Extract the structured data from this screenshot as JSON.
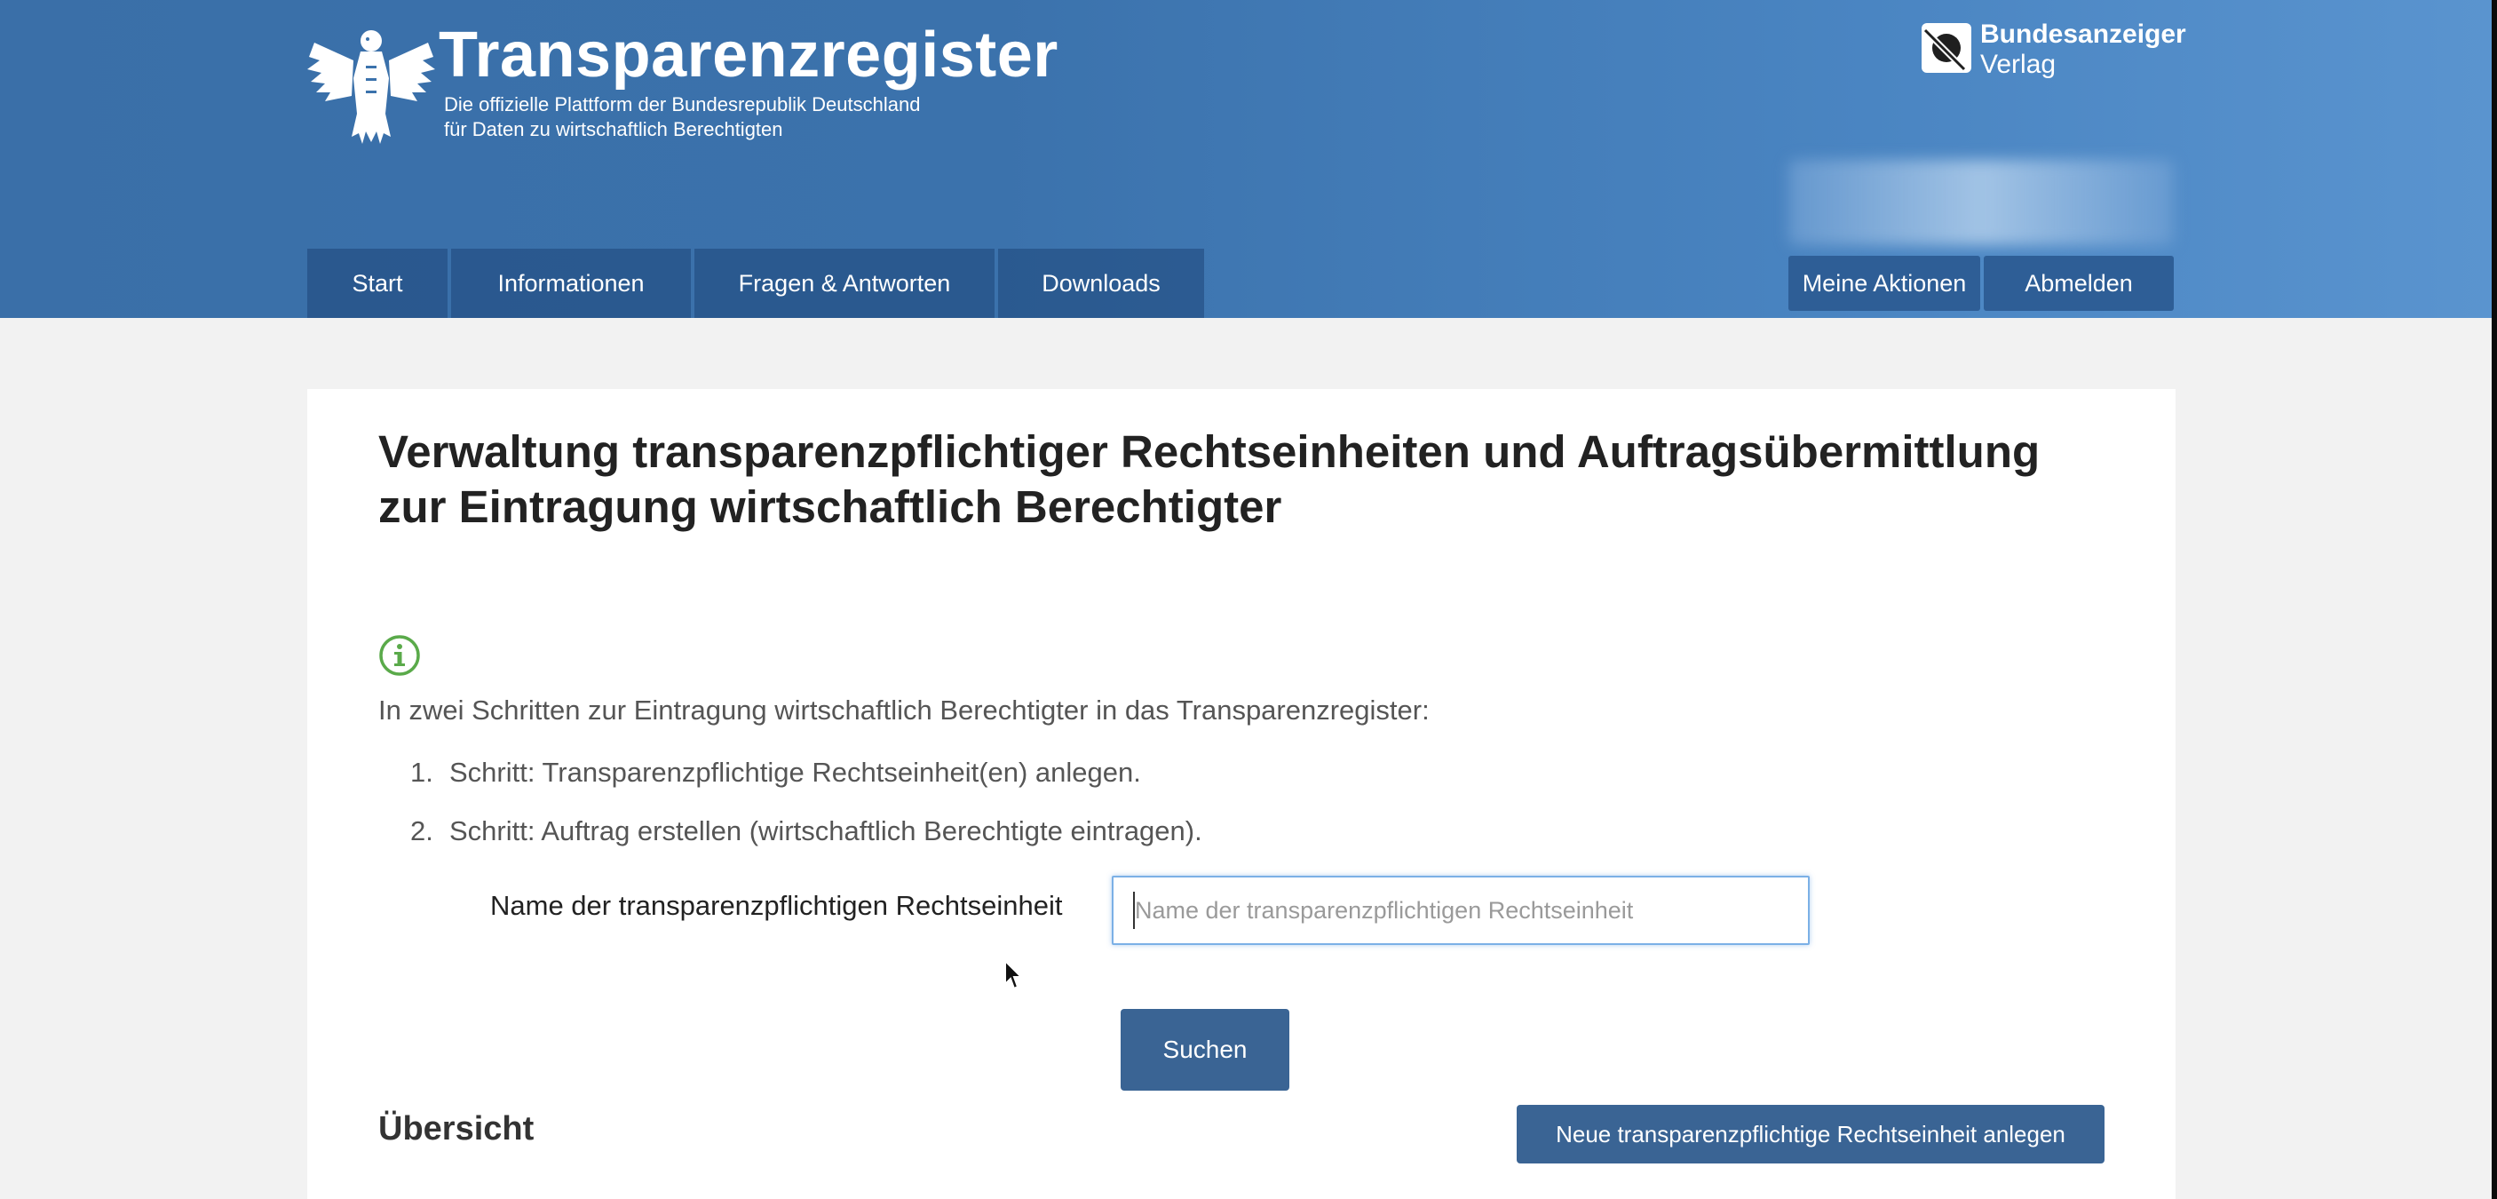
{
  "header": {
    "brand_title": "Transparenzregister",
    "brand_subtitle_line1": "Die offizielle Plattform der Bundesrepublik Deutschland",
    "brand_subtitle_line2": "für Daten zu wirtschaftlich Berechtigten",
    "publisher_line1": "Bundesanzeiger",
    "publisher_line2": "Verlag",
    "nav": [
      {
        "label": "Start"
      },
      {
        "label": "Informationen"
      },
      {
        "label": "Fragen & Antworten"
      },
      {
        "label": "Downloads"
      }
    ],
    "user_actions": {
      "my_actions_label": "Meine Aktionen",
      "logout_label": "Abmelden"
    },
    "colors": {
      "header_blue": "#3b72ac",
      "button_blue": "#3a6494"
    }
  },
  "main": {
    "title": "Verwaltung transparenzpflichtiger Rechtseinheiten und Auftragsübermittlung zur Eintragung wirtschaftlich Berechtigter",
    "intro": "In zwei Schritten zur Eintragung wirtschaftlich Berechtigter in das Transparenzregister:",
    "steps": [
      {
        "num": "1.",
        "text": "Schritt: Transparenzpflichtige Rechtseinheit(en) anlegen."
      },
      {
        "num": "2.",
        "text": "Schritt: Auftrag erstellen (wirtschaftlich Berechtigte eintragen)."
      }
    ],
    "search": {
      "label": "Name der transparenzpflichtigen Rechtseinheit",
      "placeholder": "Name der transparenzpflichtigen Rechtseinheit",
      "value": "",
      "button_label": "Suchen"
    },
    "overview": {
      "title": "Übersicht",
      "new_button_label": "Neue transparenzpflichtige Rechtseinheit anlegen"
    }
  }
}
